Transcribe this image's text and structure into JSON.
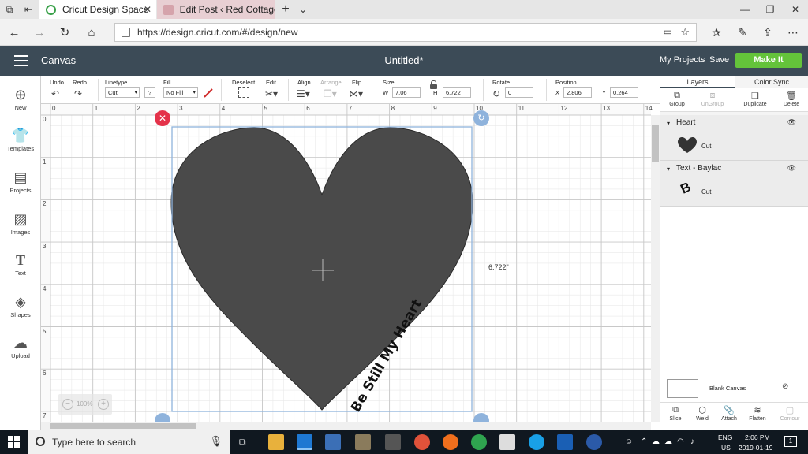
{
  "browser": {
    "tabs": [
      {
        "title": "Cricut Design Space",
        "active": true
      },
      {
        "title": "Edit Post ‹ Red Cottage Chr",
        "active": false
      }
    ],
    "url": "https://design.cricut.com/#/design/new"
  },
  "header": {
    "section": "Canvas",
    "document_title": "Untitled*",
    "my_projects": "My Projects",
    "save": "Save",
    "make_it": "Make It",
    "accent": "#64c33a"
  },
  "toolbar": {
    "undo": "Undo",
    "redo": "Redo",
    "linetype_label": "Linetype",
    "linetype_value": "Cut",
    "help": "?",
    "fill_label": "Fill",
    "fill_value": "No Fill",
    "deselect": "Deselect",
    "edit": "Edit",
    "align": "Align",
    "arrange": "Arrange",
    "flip": "Flip",
    "size_label": "Size",
    "w_label": "W",
    "w_value": "7.06",
    "h_label": "H",
    "h_value": "6.722",
    "rotate_label": "Rotate",
    "rotate_value": "0",
    "position_label": "Position",
    "x_label": "X",
    "x_value": "2.806",
    "y_label": "Y",
    "y_value": "0.264"
  },
  "sidebar": {
    "items": [
      {
        "label": "New",
        "icon": "plus-circle-icon"
      },
      {
        "label": "Templates",
        "icon": "shirt-icon"
      },
      {
        "label": "Projects",
        "icon": "notebook-icon"
      },
      {
        "label": "Images",
        "icon": "image-icon"
      },
      {
        "label": "Text",
        "icon": "text-icon"
      },
      {
        "label": "Shapes",
        "icon": "shapes-icon"
      },
      {
        "label": "Upload",
        "icon": "cloud-upload-icon"
      }
    ]
  },
  "canvas": {
    "ruler_top": [
      "0",
      "1",
      "2",
      "3",
      "4",
      "5",
      "6",
      "7",
      "8",
      "9",
      "10",
      "11",
      "12",
      "13",
      "14"
    ],
    "ruler_left": [
      "0",
      "1",
      "2",
      "3",
      "4",
      "5",
      "6",
      "7"
    ],
    "height_readout": "6.722\"",
    "zoom": "100%",
    "zoom_minus": "−",
    "zoom_plus": "+",
    "heart_text": "Be Still My Heart",
    "heart_color": "#4a4a4a",
    "selection_color": "#8fb3dc",
    "delete_handle_color": "#e4324a"
  },
  "right_panel": {
    "tabs": [
      "Layers",
      "Color Sync"
    ],
    "tools": [
      {
        "label": "Group",
        "enabled": true
      },
      {
        "label": "UnGroup",
        "enabled": false
      },
      {
        "label": "Duplicate",
        "enabled": true
      },
      {
        "label": "Delete",
        "enabled": true
      }
    ],
    "layers": [
      {
        "name": "Heart",
        "item": "Cut"
      },
      {
        "name": "Text - Baylac",
        "item": "Cut"
      }
    ],
    "blank_canvas": "Blank Canvas",
    "bottom_tools": [
      {
        "label": "Slice",
        "enabled": true
      },
      {
        "label": "Weld",
        "enabled": true
      },
      {
        "label": "Attach",
        "enabled": true
      },
      {
        "label": "Flatten",
        "enabled": true
      },
      {
        "label": "Contour",
        "enabled": false
      }
    ]
  },
  "taskbar": {
    "search_placeholder": "Type here to search",
    "lang_top": "ENG",
    "lang_bottom": "US",
    "time": "2:06 PM",
    "date": "2019-01-19",
    "notifications": "1"
  }
}
